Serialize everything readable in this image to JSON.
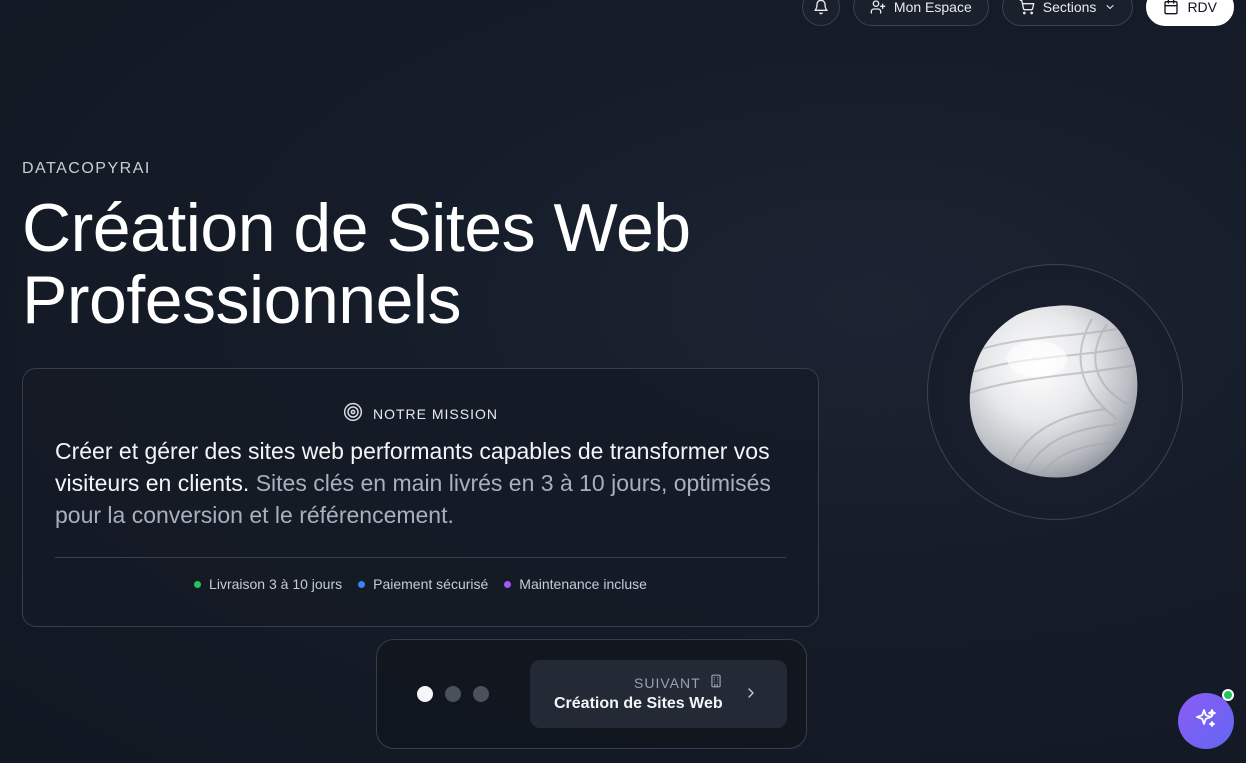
{
  "nav": {
    "notifications_icon": "bell-icon",
    "account_label": "Mon Espace",
    "account_icon": "user-plus-icon",
    "sections_label": "Sections",
    "sections_icon": "shopping-cart-icon",
    "rdv_label": "RDV",
    "rdv_icon": "calendar-icon"
  },
  "hero": {
    "eyebrow": "DATACOPYRAI",
    "title_line1": "Création de Sites Web",
    "title_line2": "Professionnels"
  },
  "mission": {
    "heading": "NOTRE MISSION",
    "heading_icon": "target-icon",
    "text_main": "Créer et gérer des sites web performants capables de transformer vos visiteurs en clients.",
    "text_muted": "Sites clés en main livrés en 3 à 10 jours, optimisés pour la conversion et le référencement.",
    "features": [
      {
        "label": "Livraison 3 à 10 jours",
        "color": "#22c55e"
      },
      {
        "label": "Paiement sécurisé",
        "color": "#3b82f6"
      },
      {
        "label": "Maintenance incluse",
        "color": "#a855f7"
      }
    ]
  },
  "pager": {
    "active_index": 0,
    "count": 3,
    "next_kicker": "SUIVANT",
    "next_kicker_icon": "building-icon",
    "next_title": "Création de Sites Web",
    "next_icon": "chevron-right-icon"
  },
  "ai_assistant": {
    "icon": "sparkles-icon",
    "status": "online",
    "status_color": "#22c55e"
  },
  "colors": {
    "background": "#151c28",
    "card_border": "#363e4d",
    "accent_gradient_start": "#8b5cf6",
    "accent_gradient_end": "#6366f1"
  }
}
